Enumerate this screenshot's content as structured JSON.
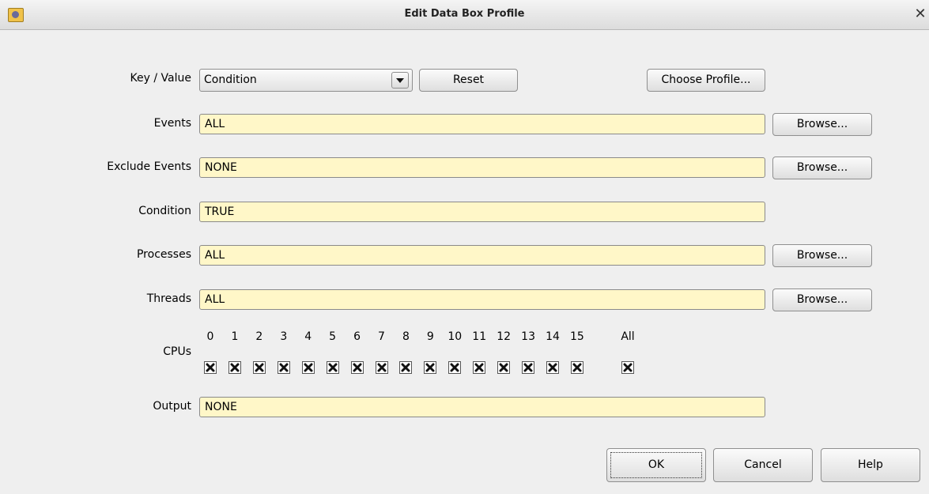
{
  "window": {
    "title": "Edit Data Box Profile",
    "close_glyph": "✕"
  },
  "key_value": {
    "label": "Key / Value",
    "selected": "Condition"
  },
  "buttons": {
    "reset": "Reset",
    "choose_profile": "Choose Profile...",
    "browse": "Browse...",
    "ok": "OK",
    "cancel": "Cancel",
    "help": "Help"
  },
  "fields": {
    "events": {
      "label": "Events",
      "value": "ALL"
    },
    "exclude_events": {
      "label": "Exclude Events",
      "value": "NONE"
    },
    "condition": {
      "label": "Condition",
      "value": "TRUE"
    },
    "processes": {
      "label": "Processes",
      "value": "ALL"
    },
    "threads": {
      "label": "Threads",
      "value": "ALL"
    },
    "output": {
      "label": "Output",
      "value": "NONE"
    }
  },
  "cpus": {
    "label": "CPUs",
    "numbers": [
      "0",
      "1",
      "2",
      "3",
      "4",
      "5",
      "6",
      "7",
      "8",
      "9",
      "10",
      "11",
      "12",
      "13",
      "14",
      "15"
    ],
    "all_label": "All",
    "checked": true
  },
  "colors": {
    "field_bg": "#fff7c8",
    "window_bg": "#efefef"
  },
  "icons": {
    "app": "app-icon",
    "close": "close-icon",
    "dropdown": "chevron-down-icon",
    "check": "x-check-icon"
  }
}
